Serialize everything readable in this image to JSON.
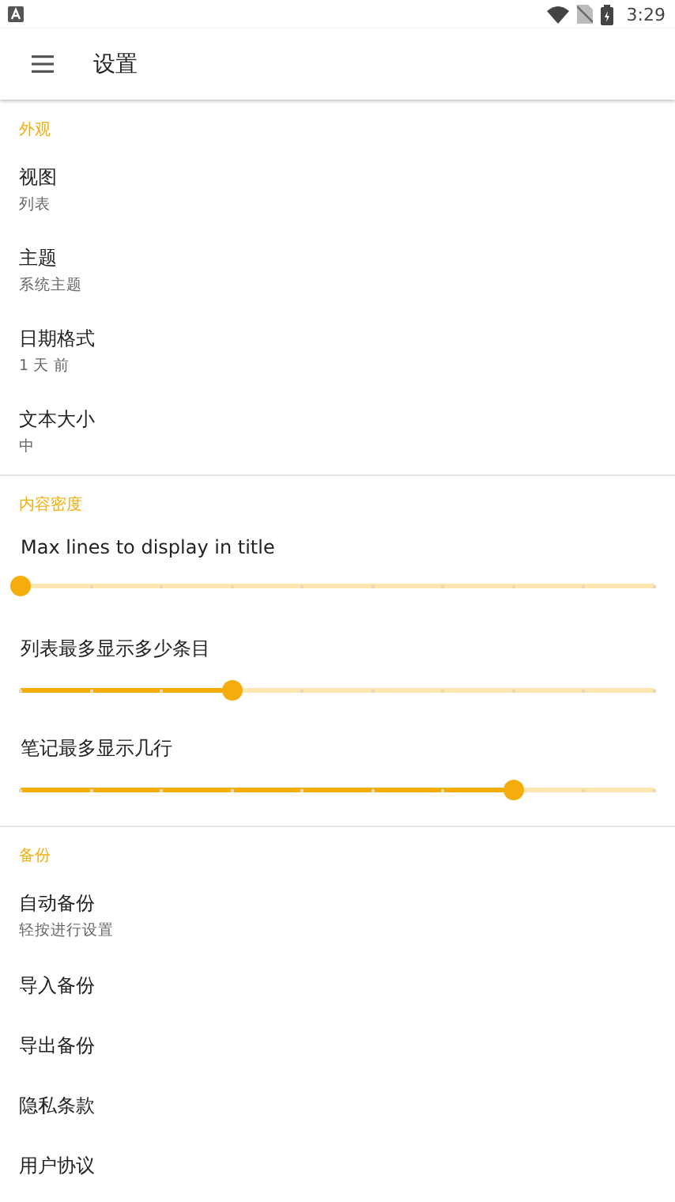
{
  "status_bar": {
    "time": "3:29"
  },
  "app_bar": {
    "title": "设置"
  },
  "sections": [
    {
      "header": "外观",
      "items": [
        {
          "kind": "pref",
          "title": "视图",
          "summary": "列表"
        },
        {
          "kind": "pref",
          "title": "主题",
          "summary": "系统主题"
        },
        {
          "kind": "pref",
          "title": "日期格式",
          "summary": "1 天 前"
        },
        {
          "kind": "pref",
          "title": "文本大小",
          "summary": "中"
        }
      ]
    },
    {
      "header": "内容密度",
      "items": [
        {
          "kind": "slider",
          "title": "Max lines to display in title",
          "level": 0
        },
        {
          "kind": "slider",
          "title": "列表最多显示多少条目",
          "level": 0.333
        },
        {
          "kind": "slider",
          "title": "笔记最多显示几行",
          "level": 0.778
        }
      ]
    },
    {
      "header": "备份",
      "items": [
        {
          "kind": "pref",
          "title": "自动备份",
          "summary": "轻按进行设置"
        },
        {
          "kind": "pref",
          "title": "导入备份"
        },
        {
          "kind": "pref",
          "title": "导出备份"
        },
        {
          "kind": "pref",
          "title": "隐私条款"
        },
        {
          "kind": "pref",
          "title": "用户协议"
        }
      ]
    }
  ]
}
